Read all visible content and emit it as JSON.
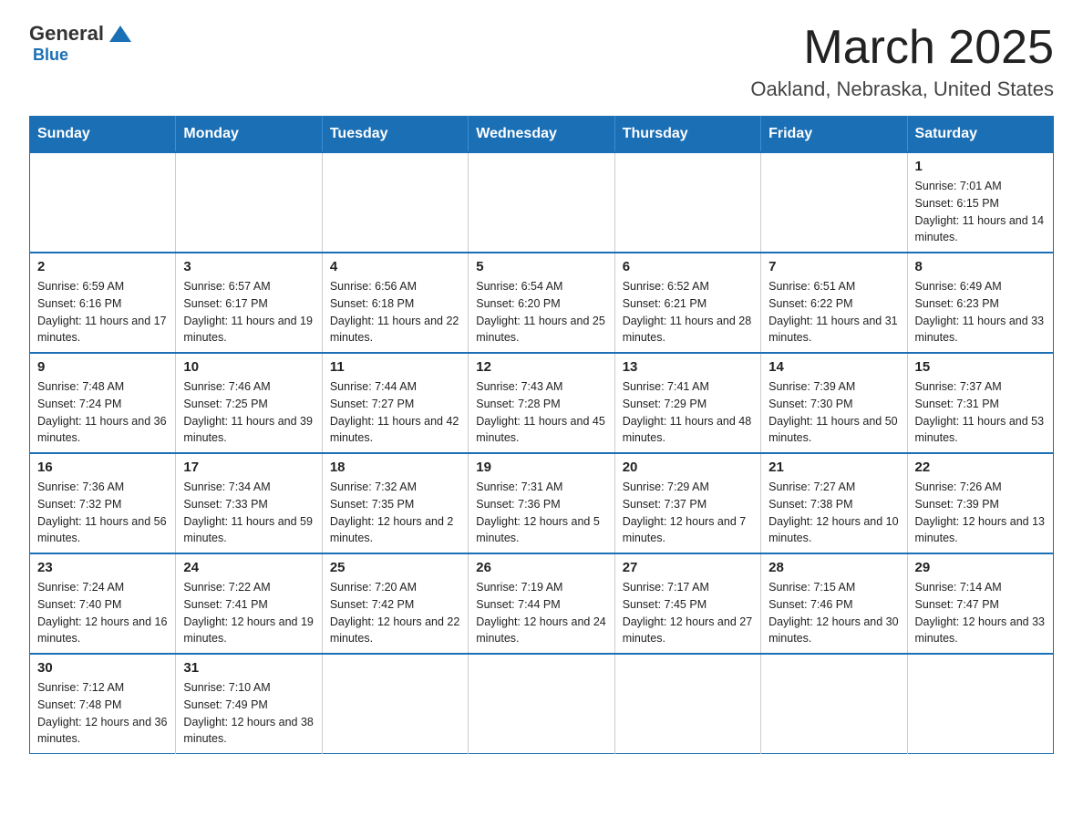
{
  "logo": {
    "general": "General",
    "blue": "Blue"
  },
  "header": {
    "title": "March 2025",
    "location": "Oakland, Nebraska, United States"
  },
  "days_of_week": [
    "Sunday",
    "Monday",
    "Tuesday",
    "Wednesday",
    "Thursday",
    "Friday",
    "Saturday"
  ],
  "weeks": [
    [
      {
        "day": "",
        "info": ""
      },
      {
        "day": "",
        "info": ""
      },
      {
        "day": "",
        "info": ""
      },
      {
        "day": "",
        "info": ""
      },
      {
        "day": "",
        "info": ""
      },
      {
        "day": "",
        "info": ""
      },
      {
        "day": "1",
        "info": "Sunrise: 7:01 AM\nSunset: 6:15 PM\nDaylight: 11 hours and 14 minutes."
      }
    ],
    [
      {
        "day": "2",
        "info": "Sunrise: 6:59 AM\nSunset: 6:16 PM\nDaylight: 11 hours and 17 minutes."
      },
      {
        "day": "3",
        "info": "Sunrise: 6:57 AM\nSunset: 6:17 PM\nDaylight: 11 hours and 19 minutes."
      },
      {
        "day": "4",
        "info": "Sunrise: 6:56 AM\nSunset: 6:18 PM\nDaylight: 11 hours and 22 minutes."
      },
      {
        "day": "5",
        "info": "Sunrise: 6:54 AM\nSunset: 6:20 PM\nDaylight: 11 hours and 25 minutes."
      },
      {
        "day": "6",
        "info": "Sunrise: 6:52 AM\nSunset: 6:21 PM\nDaylight: 11 hours and 28 minutes."
      },
      {
        "day": "7",
        "info": "Sunrise: 6:51 AM\nSunset: 6:22 PM\nDaylight: 11 hours and 31 minutes."
      },
      {
        "day": "8",
        "info": "Sunrise: 6:49 AM\nSunset: 6:23 PM\nDaylight: 11 hours and 33 minutes."
      }
    ],
    [
      {
        "day": "9",
        "info": "Sunrise: 7:48 AM\nSunset: 7:24 PM\nDaylight: 11 hours and 36 minutes."
      },
      {
        "day": "10",
        "info": "Sunrise: 7:46 AM\nSunset: 7:25 PM\nDaylight: 11 hours and 39 minutes."
      },
      {
        "day": "11",
        "info": "Sunrise: 7:44 AM\nSunset: 7:27 PM\nDaylight: 11 hours and 42 minutes."
      },
      {
        "day": "12",
        "info": "Sunrise: 7:43 AM\nSunset: 7:28 PM\nDaylight: 11 hours and 45 minutes."
      },
      {
        "day": "13",
        "info": "Sunrise: 7:41 AM\nSunset: 7:29 PM\nDaylight: 11 hours and 48 minutes."
      },
      {
        "day": "14",
        "info": "Sunrise: 7:39 AM\nSunset: 7:30 PM\nDaylight: 11 hours and 50 minutes."
      },
      {
        "day": "15",
        "info": "Sunrise: 7:37 AM\nSunset: 7:31 PM\nDaylight: 11 hours and 53 minutes."
      }
    ],
    [
      {
        "day": "16",
        "info": "Sunrise: 7:36 AM\nSunset: 7:32 PM\nDaylight: 11 hours and 56 minutes."
      },
      {
        "day": "17",
        "info": "Sunrise: 7:34 AM\nSunset: 7:33 PM\nDaylight: 11 hours and 59 minutes."
      },
      {
        "day": "18",
        "info": "Sunrise: 7:32 AM\nSunset: 7:35 PM\nDaylight: 12 hours and 2 minutes."
      },
      {
        "day": "19",
        "info": "Sunrise: 7:31 AM\nSunset: 7:36 PM\nDaylight: 12 hours and 5 minutes."
      },
      {
        "day": "20",
        "info": "Sunrise: 7:29 AM\nSunset: 7:37 PM\nDaylight: 12 hours and 7 minutes."
      },
      {
        "day": "21",
        "info": "Sunrise: 7:27 AM\nSunset: 7:38 PM\nDaylight: 12 hours and 10 minutes."
      },
      {
        "day": "22",
        "info": "Sunrise: 7:26 AM\nSunset: 7:39 PM\nDaylight: 12 hours and 13 minutes."
      }
    ],
    [
      {
        "day": "23",
        "info": "Sunrise: 7:24 AM\nSunset: 7:40 PM\nDaylight: 12 hours and 16 minutes."
      },
      {
        "day": "24",
        "info": "Sunrise: 7:22 AM\nSunset: 7:41 PM\nDaylight: 12 hours and 19 minutes."
      },
      {
        "day": "25",
        "info": "Sunrise: 7:20 AM\nSunset: 7:42 PM\nDaylight: 12 hours and 22 minutes."
      },
      {
        "day": "26",
        "info": "Sunrise: 7:19 AM\nSunset: 7:44 PM\nDaylight: 12 hours and 24 minutes."
      },
      {
        "day": "27",
        "info": "Sunrise: 7:17 AM\nSunset: 7:45 PM\nDaylight: 12 hours and 27 minutes."
      },
      {
        "day": "28",
        "info": "Sunrise: 7:15 AM\nSunset: 7:46 PM\nDaylight: 12 hours and 30 minutes."
      },
      {
        "day": "29",
        "info": "Sunrise: 7:14 AM\nSunset: 7:47 PM\nDaylight: 12 hours and 33 minutes."
      }
    ],
    [
      {
        "day": "30",
        "info": "Sunrise: 7:12 AM\nSunset: 7:48 PM\nDaylight: 12 hours and 36 minutes."
      },
      {
        "day": "31",
        "info": "Sunrise: 7:10 AM\nSunset: 7:49 PM\nDaylight: 12 hours and 38 minutes."
      },
      {
        "day": "",
        "info": ""
      },
      {
        "day": "",
        "info": ""
      },
      {
        "day": "",
        "info": ""
      },
      {
        "day": "",
        "info": ""
      },
      {
        "day": "",
        "info": ""
      }
    ]
  ]
}
